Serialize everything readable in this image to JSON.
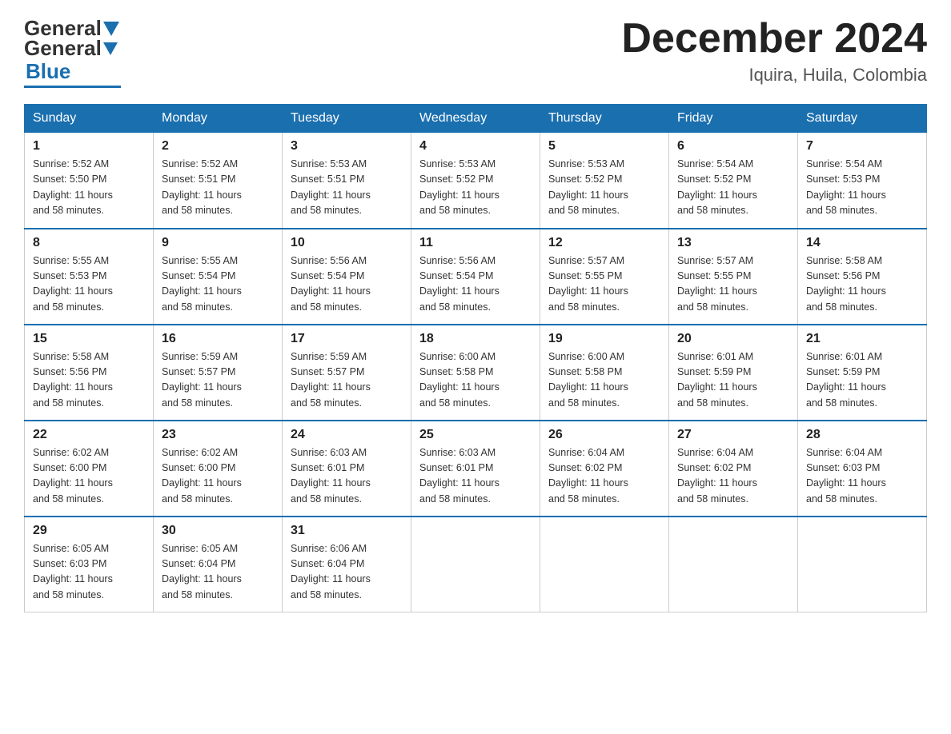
{
  "header": {
    "logo_general": "General",
    "logo_blue": "Blue",
    "title": "December 2024",
    "location": "Iquira, Huila, Colombia"
  },
  "days_of_week": [
    "Sunday",
    "Monday",
    "Tuesday",
    "Wednesday",
    "Thursday",
    "Friday",
    "Saturday"
  ],
  "weeks": [
    [
      {
        "day": "1",
        "sunrise": "5:52 AM",
        "sunset": "5:50 PM",
        "daylight": "11 hours and 58 minutes."
      },
      {
        "day": "2",
        "sunrise": "5:52 AM",
        "sunset": "5:51 PM",
        "daylight": "11 hours and 58 minutes."
      },
      {
        "day": "3",
        "sunrise": "5:53 AM",
        "sunset": "5:51 PM",
        "daylight": "11 hours and 58 minutes."
      },
      {
        "day": "4",
        "sunrise": "5:53 AM",
        "sunset": "5:52 PM",
        "daylight": "11 hours and 58 minutes."
      },
      {
        "day": "5",
        "sunrise": "5:53 AM",
        "sunset": "5:52 PM",
        "daylight": "11 hours and 58 minutes."
      },
      {
        "day": "6",
        "sunrise": "5:54 AM",
        "sunset": "5:52 PM",
        "daylight": "11 hours and 58 minutes."
      },
      {
        "day": "7",
        "sunrise": "5:54 AM",
        "sunset": "5:53 PM",
        "daylight": "11 hours and 58 minutes."
      }
    ],
    [
      {
        "day": "8",
        "sunrise": "5:55 AM",
        "sunset": "5:53 PM",
        "daylight": "11 hours and 58 minutes."
      },
      {
        "day": "9",
        "sunrise": "5:55 AM",
        "sunset": "5:54 PM",
        "daylight": "11 hours and 58 minutes."
      },
      {
        "day": "10",
        "sunrise": "5:56 AM",
        "sunset": "5:54 PM",
        "daylight": "11 hours and 58 minutes."
      },
      {
        "day": "11",
        "sunrise": "5:56 AM",
        "sunset": "5:54 PM",
        "daylight": "11 hours and 58 minutes."
      },
      {
        "day": "12",
        "sunrise": "5:57 AM",
        "sunset": "5:55 PM",
        "daylight": "11 hours and 58 minutes."
      },
      {
        "day": "13",
        "sunrise": "5:57 AM",
        "sunset": "5:55 PM",
        "daylight": "11 hours and 58 minutes."
      },
      {
        "day": "14",
        "sunrise": "5:58 AM",
        "sunset": "5:56 PM",
        "daylight": "11 hours and 58 minutes."
      }
    ],
    [
      {
        "day": "15",
        "sunrise": "5:58 AM",
        "sunset": "5:56 PM",
        "daylight": "11 hours and 58 minutes."
      },
      {
        "day": "16",
        "sunrise": "5:59 AM",
        "sunset": "5:57 PM",
        "daylight": "11 hours and 58 minutes."
      },
      {
        "day": "17",
        "sunrise": "5:59 AM",
        "sunset": "5:57 PM",
        "daylight": "11 hours and 58 minutes."
      },
      {
        "day": "18",
        "sunrise": "6:00 AM",
        "sunset": "5:58 PM",
        "daylight": "11 hours and 58 minutes."
      },
      {
        "day": "19",
        "sunrise": "6:00 AM",
        "sunset": "5:58 PM",
        "daylight": "11 hours and 58 minutes."
      },
      {
        "day": "20",
        "sunrise": "6:01 AM",
        "sunset": "5:59 PM",
        "daylight": "11 hours and 58 minutes."
      },
      {
        "day": "21",
        "sunrise": "6:01 AM",
        "sunset": "5:59 PM",
        "daylight": "11 hours and 58 minutes."
      }
    ],
    [
      {
        "day": "22",
        "sunrise": "6:02 AM",
        "sunset": "6:00 PM",
        "daylight": "11 hours and 58 minutes."
      },
      {
        "day": "23",
        "sunrise": "6:02 AM",
        "sunset": "6:00 PM",
        "daylight": "11 hours and 58 minutes."
      },
      {
        "day": "24",
        "sunrise": "6:03 AM",
        "sunset": "6:01 PM",
        "daylight": "11 hours and 58 minutes."
      },
      {
        "day": "25",
        "sunrise": "6:03 AM",
        "sunset": "6:01 PM",
        "daylight": "11 hours and 58 minutes."
      },
      {
        "day": "26",
        "sunrise": "6:04 AM",
        "sunset": "6:02 PM",
        "daylight": "11 hours and 58 minutes."
      },
      {
        "day": "27",
        "sunrise": "6:04 AM",
        "sunset": "6:02 PM",
        "daylight": "11 hours and 58 minutes."
      },
      {
        "day": "28",
        "sunrise": "6:04 AM",
        "sunset": "6:03 PM",
        "daylight": "11 hours and 58 minutes."
      }
    ],
    [
      {
        "day": "29",
        "sunrise": "6:05 AM",
        "sunset": "6:03 PM",
        "daylight": "11 hours and 58 minutes."
      },
      {
        "day": "30",
        "sunrise": "6:05 AM",
        "sunset": "6:04 PM",
        "daylight": "11 hours and 58 minutes."
      },
      {
        "day": "31",
        "sunrise": "6:06 AM",
        "sunset": "6:04 PM",
        "daylight": "11 hours and 58 minutes."
      },
      null,
      null,
      null,
      null
    ]
  ],
  "labels": {
    "sunrise": "Sunrise:",
    "sunset": "Sunset:",
    "daylight": "Daylight:"
  }
}
